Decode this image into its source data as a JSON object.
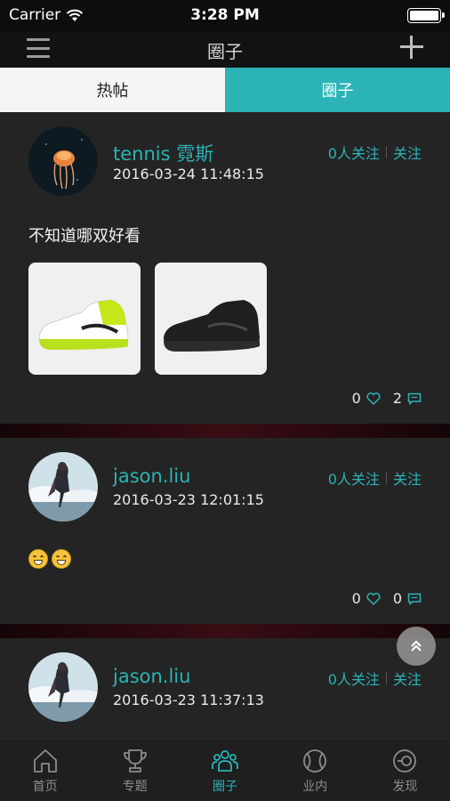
{
  "status_bar": {
    "carrier": "Carrier",
    "time": "3:28 PM"
  },
  "nav": {
    "title": "圈子"
  },
  "tabs": [
    {
      "label": "热帖",
      "active": false
    },
    {
      "label": "圈子",
      "active": true
    }
  ],
  "posts": [
    {
      "user": "tennis 霓斯",
      "time": "2016-03-24 11:48:15",
      "followers": "0人关注",
      "follow_label": "关注",
      "text": "不知道哪双好看",
      "images": [
        "green-white-sneaker",
        "black-sneaker"
      ],
      "likes": "0",
      "comments": "2"
    },
    {
      "user": "jason.liu",
      "time": "2016-03-23 12:01:15",
      "followers": "0人关注",
      "follow_label": "关注",
      "emojis": [
        "grinning-emoji",
        "grinning-emoji"
      ],
      "likes": "0",
      "comments": "0"
    },
    {
      "user": "jason.liu",
      "time": "2016-03-23 11:37:13",
      "followers": "0人关注",
      "follow_label": "关注"
    }
  ],
  "tab_bar": [
    {
      "label": "首页",
      "icon": "home-icon",
      "active": false
    },
    {
      "label": "专题",
      "icon": "trophy-icon",
      "active": false
    },
    {
      "label": "圈子",
      "icon": "group-icon",
      "active": true
    },
    {
      "label": "业内",
      "icon": "tennis-ball-icon",
      "active": false
    },
    {
      "label": "发现",
      "icon": "discover-icon",
      "active": false
    }
  ],
  "colors": {
    "accent": "#2bb3b6",
    "background": "#1c1c1c",
    "card": "#242424"
  }
}
